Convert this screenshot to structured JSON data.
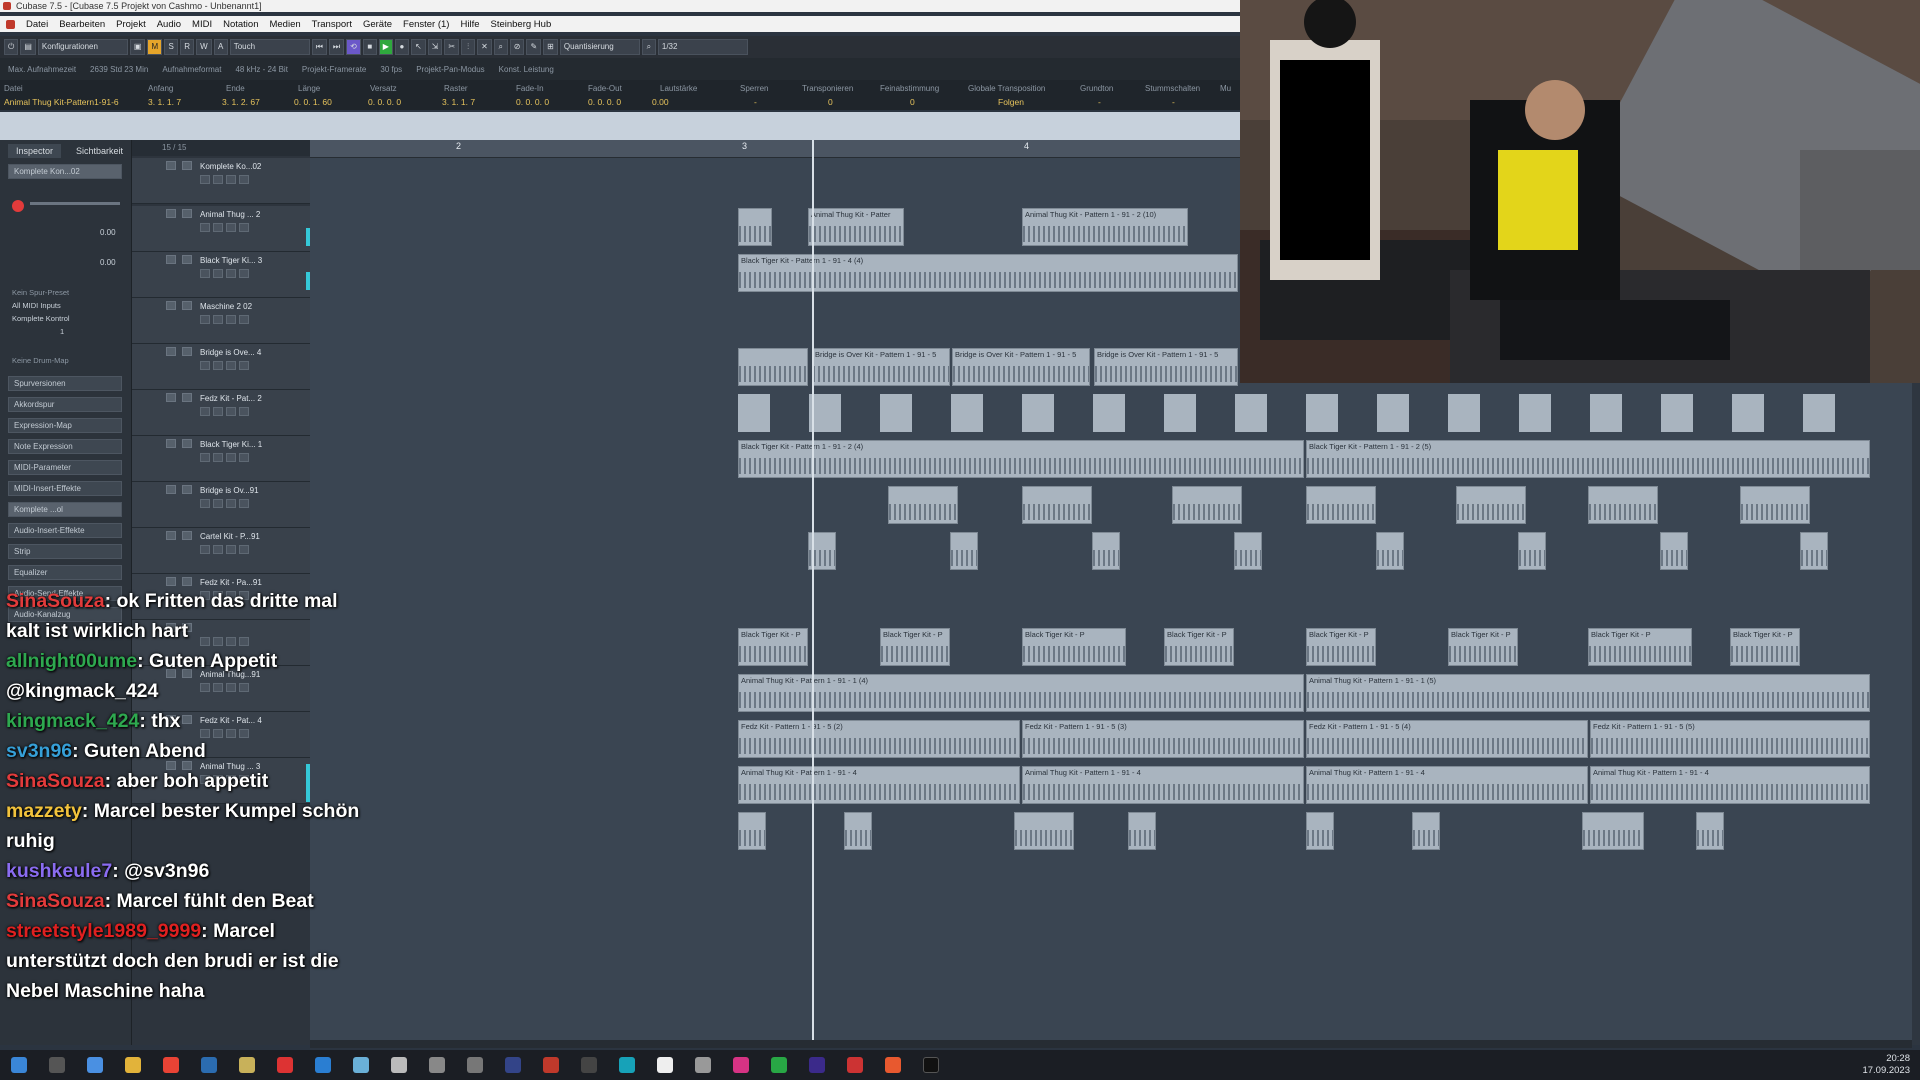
{
  "window": {
    "title": "Cubase 7.5 - [Cubase 7.5 Projekt von Cashmo - Unbenannt1]"
  },
  "menu": [
    "Datei",
    "Bearbeiten",
    "Projekt",
    "Audio",
    "MIDI",
    "Notation",
    "Medien",
    "Transport",
    "Geräte",
    "Fenster (1)",
    "Hilfe",
    "Steinberg Hub"
  ],
  "toolbar": {
    "config_label": "Konfigurationen",
    "mode_label": "Touch",
    "quantize_label": "Quantisierung",
    "quantize_value": "1/32",
    "m_label": "M",
    "s_label": "S",
    "r_label": "R",
    "w_label": "W",
    "a_label": "A"
  },
  "statusbar": [
    "Max. Aufnahmezeit",
    "2639 Std 23 Min",
    "Aufnahmeformat",
    "48 kHz - 24 Bit",
    "Projekt-Framerate",
    "30 fps",
    "Projekt-Pan-Modus",
    "Konst. Leistung"
  ],
  "infoline": {
    "headers": [
      "Datei",
      "Anfang",
      "Ende",
      "Länge",
      "Versatz",
      "Raster",
      "Fade-In",
      "Fade-Out",
      "Lautstärke",
      "Sperren",
      "Transponieren",
      "Feinabstimmung",
      "Globale Transposition",
      "Grundton",
      "Stummschalten",
      "Mu"
    ],
    "values": [
      "Animal Thug Kit-Pattern1-91-6",
      "3. 1. 1. 7",
      "3. 1. 2. 67",
      "0. 0. 1. 60",
      "0. 0. 0. 0",
      "3. 1. 1. 7",
      "0. 0. 0. 0",
      "0. 0. 0. 0",
      "0.00",
      "-",
      "0",
      "0",
      "Folgen",
      "-",
      "-"
    ]
  },
  "inspector": {
    "tabs": [
      "Inspector",
      "Sichtbarkeit"
    ],
    "track_name": "Komplete Kon...02",
    "fader_values": [
      "0.00",
      "0.00"
    ],
    "routing": [
      "Kein Spur-Preset",
      "All MIDI Inputs",
      "Komplete Kontrol",
      "1"
    ],
    "drum_map": "Keine Drum-Map",
    "sections": [
      "Spurversionen",
      "Akkordspur",
      "Expression-Map",
      "Note Expression",
      "MIDI-Parameter",
      "MIDI-Insert-Effekte",
      "Komplete ...ol",
      "Audio-Insert-Effekte",
      "Strip",
      "Equalizer",
      "Audio-Send-Effekte",
      "Audio-Kanalzug"
    ]
  },
  "tracklist": {
    "header": "15 / 15",
    "tracks": [
      "Komplete Ko...02",
      "Animal Thug ... 2",
      "Black Tiger Ki... 3",
      "Maschine 2 02",
      "Bridge is Ove... 4",
      "Fedz Kit - Pat... 2",
      "Black Tiger Ki... 1",
      "Bridge is Ov...91",
      "Cartel Kit - P...91",
      "Fedz Kit - Pa...91",
      "",
      "Animal Thug...91",
      "Fedz Kit - Pat... 4",
      "Animal Thug ... 3"
    ]
  },
  "timeline": {
    "marks": [
      "2",
      "3",
      "4"
    ]
  },
  "clips": {
    "animal_thug_2": "Animal Thug Kit - Patter",
    "animal_thug_2b": "Animal Thug Kit - Pattern 1 - 91 - 2 (10)",
    "black_tiger_3": "Black Tiger Kit - Pattern 1 - 91 - 4 (4)",
    "bridge_1": "Bridge is Over Kit - Pattern 1 - 91 - 5",
    "bridge_2": "Bridge is Over Kit - Pattern 1 - 91 - 5",
    "bridge_3": "Bridge is Over Kit - Pattern 1 - 91 - 5",
    "black_tiger_1a": "Black Tiger Kit - Pattern 1 - 91 - 2 (4)",
    "black_tiger_1b": "Black Tiger Kit - Pattern 1 - 91 - 2 (5)",
    "black_tiger_short": "Black Tiger Kit - P",
    "animal_thug_1a": "Animal Thug Kit - Pattern 1 - 91 - 1 (4)",
    "animal_thug_1b": "Animal Thug Kit - Pattern 1 - 91 - 1 (5)",
    "fedz_a": "Fedz Kit - Pattern 1 - 91 - 5 (2)",
    "fedz_b": "Fedz Kit - Pattern 1 - 91 - 5 (3)",
    "fedz_c": "Fedz Kit - Pattern 1 - 91 - 5 (4)",
    "fedz_d": "Fedz Kit - Pattern 1 - 91 - 5 (5)",
    "animal_thug_4": "Animal Thug Kit - Pattern 1 - 91 - 4"
  },
  "chat": [
    {
      "user": "SinaSouza",
      "color": "#e23b3b",
      "text": ": ok Fritten das dritte mal kalt ist wirklich hart"
    },
    {
      "user": "allnight00ume",
      "color": "#2ea84f",
      "text": ": Guten Appetit @kingmack_424"
    },
    {
      "user": "kingmack_424",
      "color": "#2ea84f",
      "text": ": thx"
    },
    {
      "user": "sv3n96",
      "color": "#36a0d8",
      "text": ": Guten Abend"
    },
    {
      "user": "SinaSouza",
      "color": "#e23b3b",
      "text": ": aber boh appetit"
    },
    {
      "user": "mazzety",
      "color": "#f2c33c",
      "text": ": Marcel bester Kumpel schön ruhig"
    },
    {
      "user": "kushkeule7",
      "color": "#8a6cf0",
      "text": ": @sv3n96"
    },
    {
      "user": "SinaSouza",
      "color": "#e23b3b",
      "text": ": Marcel fühlt den Beat"
    },
    {
      "user": "streetstyle1989_9999",
      "color": "#e02020",
      "text": ": Marcel unterstützt doch den brudi er ist die Nebel Maschine haha"
    }
  ],
  "clock": {
    "time": "20:28",
    "date": "17.09.2023"
  },
  "colors": {
    "accent": "#6b58c9",
    "play": "#2fa83d",
    "record": "#e23b3b",
    "meter": "#35c8d8"
  }
}
